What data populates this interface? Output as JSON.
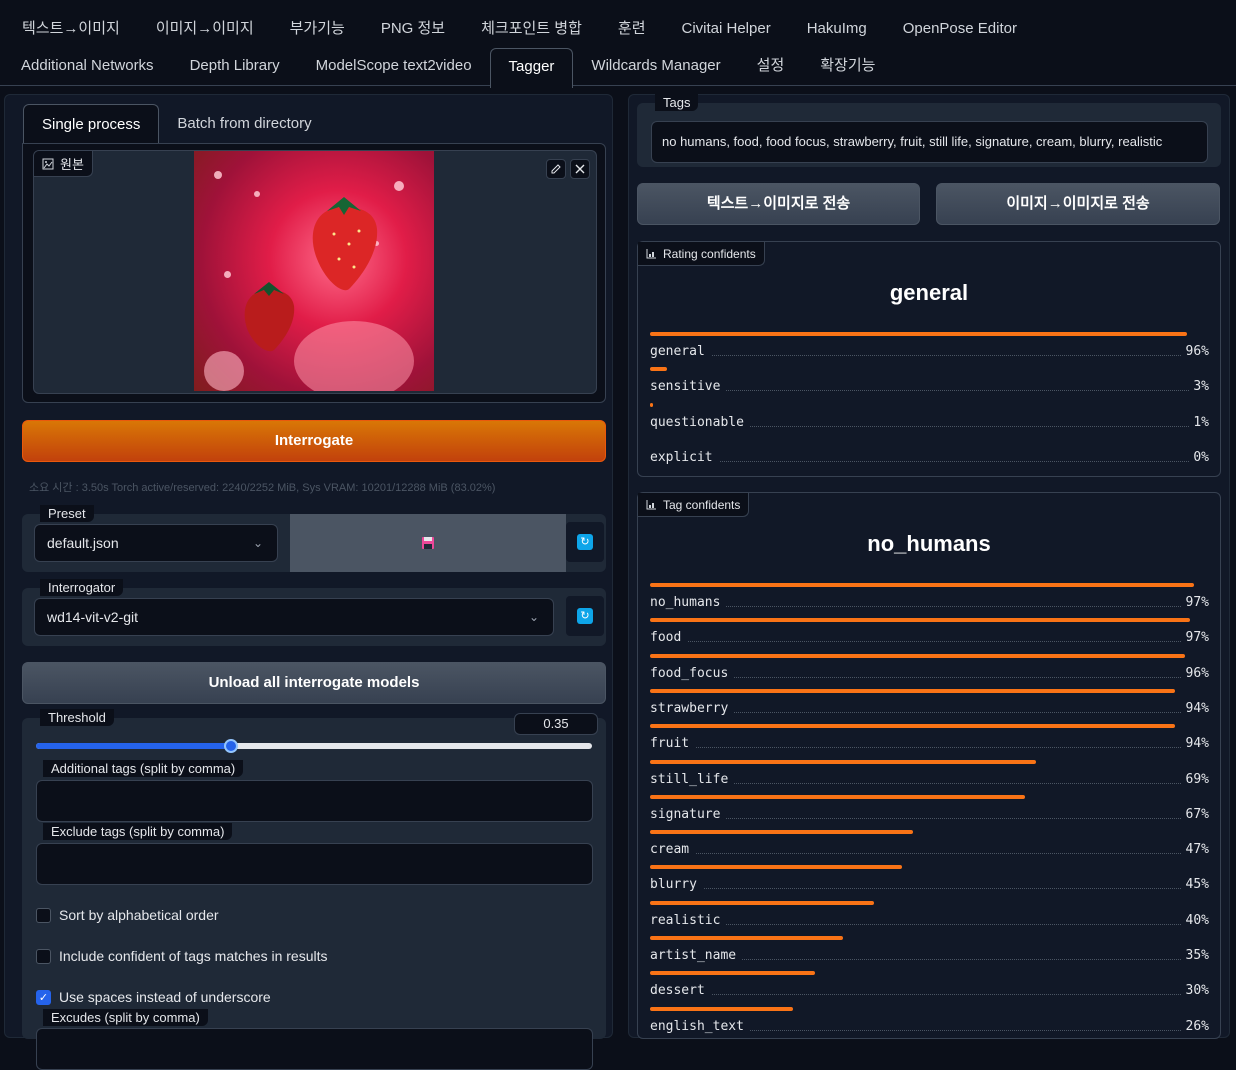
{
  "top_tabs_row1": [
    "텍스트→이미지",
    "이미지→이미지",
    "부가기능",
    "PNG 정보",
    "체크포인트 병합",
    "훈련",
    "Civitai Helper",
    "HakuImg",
    "OpenPose Editor"
  ],
  "top_tabs_row2": [
    "Additional Networks",
    "Depth Library",
    "ModelScope text2video",
    "Tagger",
    "Wildcards Manager",
    "설정",
    "확장기능"
  ],
  "left": {
    "subtabs": [
      "Single process",
      "Batch from directory"
    ],
    "image_label": "원본",
    "interrogate_label": "Interrogate",
    "timing": "소요 시간 : 3.50s  Torch active/reserved: 2240/2252 MiB, Sys VRAM: 10201/12288 MiB (83.02%)",
    "preset": {
      "label": "Preset",
      "value": "default.json"
    },
    "interrogator": {
      "label": "Interrogator",
      "value": "wd14-vit-v2-git"
    },
    "unload_label": "Unload all interrogate models",
    "threshold": {
      "label": "Threshold",
      "value": "0.35",
      "fraction": 0.35
    },
    "additional_tags_label": "Additional tags (split by comma)",
    "exclude_tags_label": "Exclude tags (split by comma)",
    "sort_alpha_label": "Sort by alphabetical order",
    "include_conf_label": "Include confident of tags matches in results",
    "use_spaces_label": "Use spaces instead of underscore",
    "excudes_label": "Excudes (split by comma)"
  },
  "right": {
    "tags_label": "Tags",
    "tags_value": "no humans, food, food focus, strawberry, fruit, still life, signature, cream, blurry, realistic",
    "send_txt2img": "텍스트→이미지로 전송",
    "send_img2img": "이미지→이미지로 전송",
    "rating": {
      "label": "Rating confidents",
      "title": "general",
      "items": [
        {
          "name": "general",
          "pct": "96%",
          "value": 0.96
        },
        {
          "name": "sensitive",
          "pct": "3%",
          "value": 0.03
        },
        {
          "name": "questionable",
          "pct": "1%",
          "value": 0.005
        },
        {
          "name": "explicit",
          "pct": "0%",
          "value": 0.0
        }
      ]
    },
    "tag_conf": {
      "label": "Tag confidents",
      "title": "no_humans",
      "items": [
        {
          "name": "no_humans",
          "pct": "97%",
          "value": 0.974
        },
        {
          "name": "food",
          "pct": "97%",
          "value": 0.966
        },
        {
          "name": "food_focus",
          "pct": "96%",
          "value": 0.957
        },
        {
          "name": "strawberry",
          "pct": "94%",
          "value": 0.94
        },
        {
          "name": "fruit",
          "pct": "94%",
          "value": 0.94
        },
        {
          "name": "still_life",
          "pct": "69%",
          "value": 0.69
        },
        {
          "name": "signature",
          "pct": "67%",
          "value": 0.67
        },
        {
          "name": "cream",
          "pct": "47%",
          "value": 0.47
        },
        {
          "name": "blurry",
          "pct": "45%",
          "value": 0.45
        },
        {
          "name": "realistic",
          "pct": "40%",
          "value": 0.4
        },
        {
          "name": "artist_name",
          "pct": "35%",
          "value": 0.345
        },
        {
          "name": "dessert",
          "pct": "30%",
          "value": 0.295
        },
        {
          "name": "english_text",
          "pct": "26%",
          "value": 0.255
        }
      ]
    }
  },
  "colors": {
    "accent": "#f97316",
    "primary_button": "#c2410c",
    "slider": "#2563eb"
  }
}
